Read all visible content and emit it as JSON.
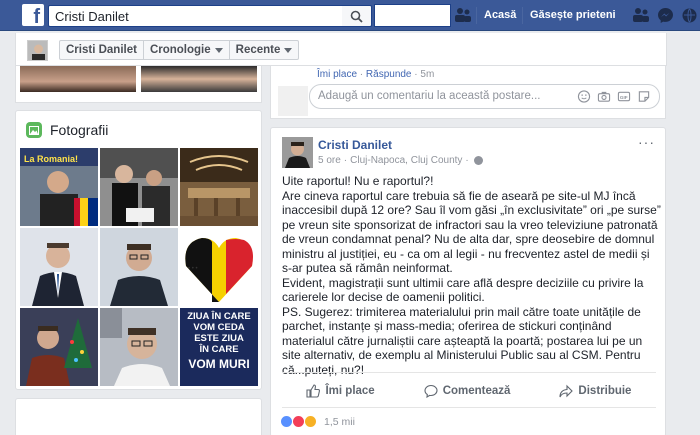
{
  "topbar": {
    "logo": "f",
    "search_value": "Cristi Danilet",
    "nav_home": "Acasă",
    "nav_find_friends": "Găsește prieteni",
    "colors": {
      "bar": "#3b5998"
    }
  },
  "profile_nav": {
    "name": "Cristi Danilet",
    "timeline": "Cronologie",
    "recent": "Recente"
  },
  "photos": {
    "title": "Fotografii",
    "tiles": [
      "photo-1",
      "photo-2",
      "photo-3",
      "photo-4",
      "photo-5",
      "photo-6",
      "photo-7",
      "photo-8",
      "photo-9"
    ],
    "tile9_text": [
      "ZIUA ÎN CARE",
      "VOM CEDA",
      "ESTE ZIUA",
      "ÎN CARE",
      "VOM MURI"
    ]
  },
  "prev_post": {
    "like": "Îmi place",
    "reply": "Răspunde",
    "time": "5m",
    "comment_placeholder": "Adaugă un comentariu la această postare..."
  },
  "post": {
    "author": "Cristi Danilet",
    "time": "5 ore",
    "location": "Cluj-Napoca, Cluj County",
    "body": [
      "Uite raportul! Nu e raportul?!",
      "Are cineva raportul care trebuia să fie de aseară pe site-ul MJ încă inaccesibil după 12 ore? Sau îl vom găsi „în exclusivitate” ori „pe surse” pe vreun site sponsorizat de infractori sau la vreo televiziune patronată de vreun condamnat penal? Nu de alta dar, spre deosebire de domnul ministru al justiției, eu - ca om al legii - nu frecventez astel de medii și s-ar putea să rămân neinformat.",
      "Evident, magistrații sunt ultimii care află despre deciziile cu privire la carierele lor decise de oamenii politici.",
      "PS. Sugerez: trimiterea materialului prin mail către toate unitățile de parchet, instanțe și mass-media; oferirea de stickuri conținând materialul către jurnaliștii care așteaptă la poartă; postarea lui pe un site alternativ, de exemplu al Ministerului Public sau al CSM. Pentru că...puteți, nu?!"
    ],
    "action_like": "Îmi place",
    "action_comment": "Comentează",
    "action_share": "Distribuie",
    "reaction_count": "1,5 mii"
  }
}
